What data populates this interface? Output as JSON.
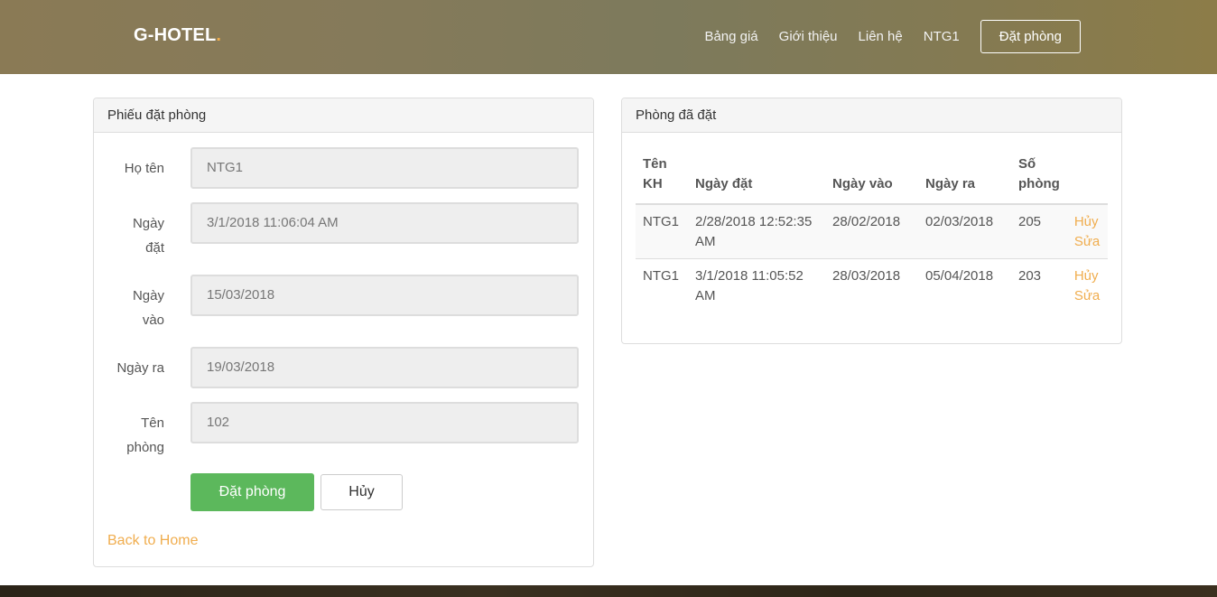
{
  "header": {
    "brand": "G-HOTEL",
    "brand_dot": ".",
    "nav": [
      "Bảng giá",
      "Giới thiệu",
      "Liên hệ",
      "NTG1"
    ],
    "book_button": "Đặt phòng"
  },
  "booking_form": {
    "title": "Phiếu đặt phòng",
    "fields": [
      {
        "label": "Họ tên",
        "value": "NTG1"
      },
      {
        "label": "Ngày đặt",
        "value": "3/1/2018 11:06:04 AM"
      },
      {
        "label": "Ngày vào",
        "value": "15/03/2018"
      },
      {
        "label": "Ngày ra",
        "value": "19/03/2018"
      },
      {
        "label": "Tên phòng",
        "value": "102"
      }
    ],
    "submit_label": "Đặt phòng",
    "cancel_label": "Hủy",
    "back_link": "Back to Home"
  },
  "booked_rooms": {
    "title": "Phòng đã đặt",
    "columns": [
      "Tên KH",
      "Ngày đặt",
      "Ngày vào",
      "Ngày ra",
      "Số phòng"
    ],
    "rows": [
      {
        "name": "NTG1",
        "booked": "2/28/2018 12:52:35 AM",
        "checkin": "28/02/2018",
        "checkout": "02/03/2018",
        "room": "205",
        "cancel": "Hủy",
        "edit": "Sửa"
      },
      {
        "name": "NTG1",
        "booked": "3/1/2018 11:05:52 AM",
        "checkin": "28/03/2018",
        "checkout": "05/04/2018",
        "room": "203",
        "cancel": "Hủy",
        "edit": "Sửa"
      }
    ]
  },
  "colors": {
    "accent": "#f0ad4e",
    "success": "#5cb85c"
  }
}
